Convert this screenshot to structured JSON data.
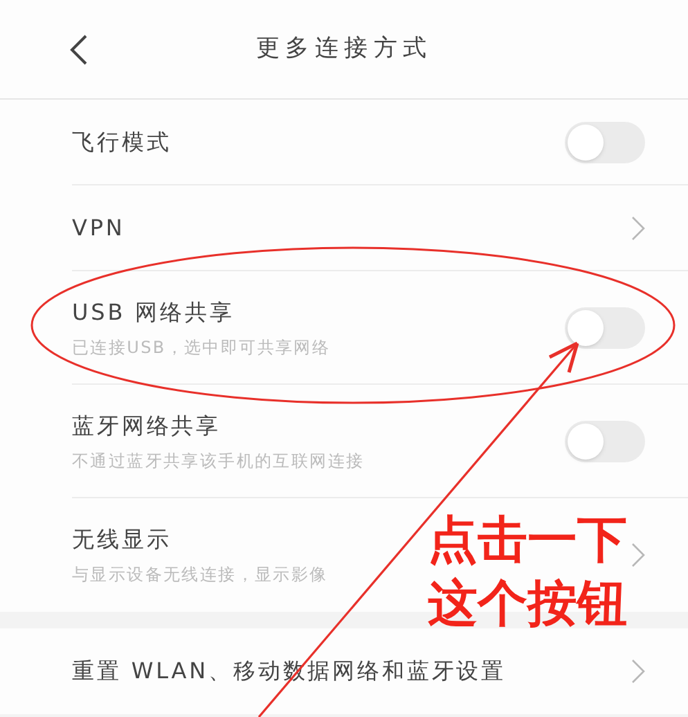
{
  "header": {
    "title": "更多连接方式"
  },
  "sections": [
    {
      "items": [
        {
          "kind": "toggle",
          "label": "飞行模式",
          "on": false
        },
        {
          "kind": "link",
          "label": "VPN"
        },
        {
          "kind": "toggle",
          "label": "USB 网络共享",
          "subtitle": "已连接USB，选中即可共享网络",
          "on": false
        },
        {
          "kind": "toggle",
          "label": "蓝牙网络共享",
          "subtitle": "不通过蓝牙共享该手机的互联网连接",
          "on": false
        },
        {
          "kind": "link",
          "label": "无线显示",
          "subtitle": "与显示设备无线连接，显示影像"
        }
      ]
    },
    {
      "items": [
        {
          "kind": "link",
          "label": "重置 WLAN、移动数据网络和蓝牙设置"
        }
      ]
    }
  ],
  "annotation": {
    "lines": [
      "点击一下",
      "这个按钮"
    ]
  }
}
